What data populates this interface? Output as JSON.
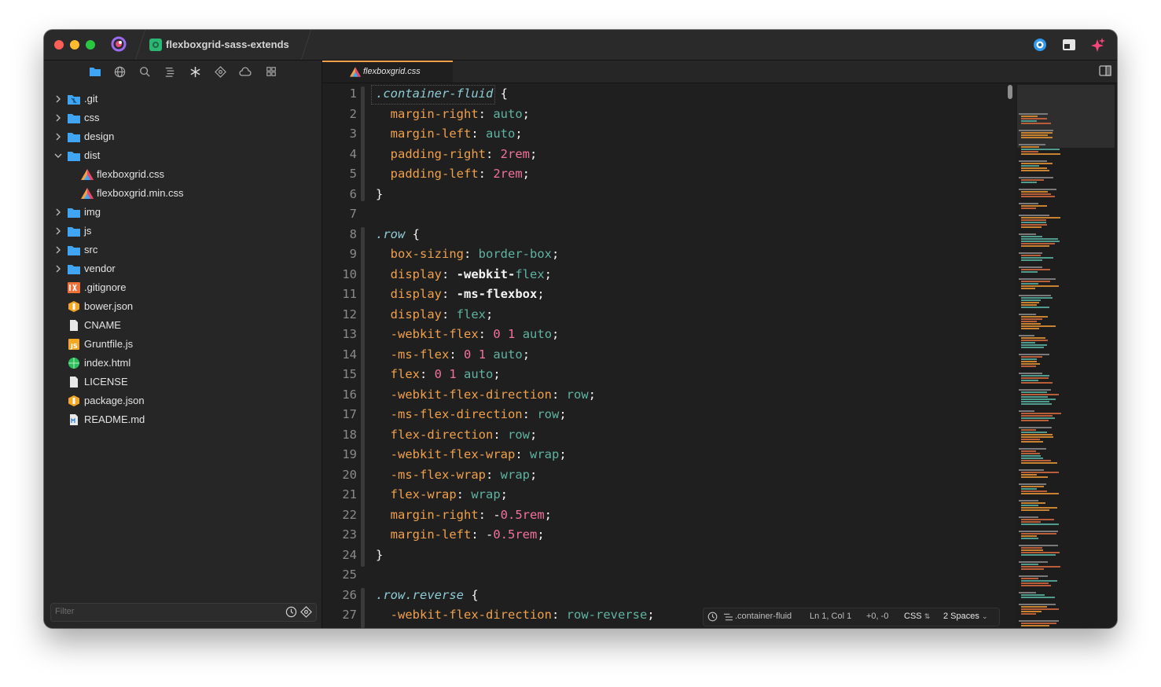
{
  "window": {
    "project_name": "flexboxgrid-sass-extends"
  },
  "sidebar": {
    "filter_placeholder": "Filter",
    "items": [
      {
        "label": ".git",
        "kind": "folder",
        "expanded": false,
        "depth": 0,
        "icon": "git-folder-icon"
      },
      {
        "label": "css",
        "kind": "folder",
        "expanded": false,
        "depth": 0,
        "icon": "folder-icon"
      },
      {
        "label": "design",
        "kind": "folder",
        "expanded": false,
        "depth": 0,
        "icon": "folder-icon"
      },
      {
        "label": "dist",
        "kind": "folder",
        "expanded": true,
        "depth": 0,
        "icon": "folder-icon"
      },
      {
        "label": "flexboxgrid.css",
        "kind": "file",
        "depth": 1,
        "icon": "css-file-icon"
      },
      {
        "label": "flexboxgrid.min.css",
        "kind": "file",
        "depth": 1,
        "icon": "css-file-icon"
      },
      {
        "label": "img",
        "kind": "folder",
        "expanded": false,
        "depth": 0,
        "icon": "folder-icon"
      },
      {
        "label": "js",
        "kind": "folder",
        "expanded": false,
        "depth": 0,
        "icon": "folder-icon"
      },
      {
        "label": "src",
        "kind": "folder",
        "expanded": false,
        "depth": 0,
        "icon": "folder-icon"
      },
      {
        "label": "vendor",
        "kind": "folder",
        "expanded": false,
        "depth": 0,
        "icon": "folder-icon"
      },
      {
        "label": ".gitignore",
        "kind": "file",
        "depth": 0,
        "icon": "gitignore-file-icon"
      },
      {
        "label": "bower.json",
        "kind": "file",
        "depth": 0,
        "icon": "json-file-icon"
      },
      {
        "label": "CNAME",
        "kind": "file",
        "depth": 0,
        "icon": "document-file-icon"
      },
      {
        "label": "Gruntfile.js",
        "kind": "file",
        "depth": 0,
        "icon": "js-file-icon"
      },
      {
        "label": "index.html",
        "kind": "file",
        "depth": 0,
        "icon": "html-file-icon"
      },
      {
        "label": "LICENSE",
        "kind": "file",
        "depth": 0,
        "icon": "document-file-icon"
      },
      {
        "label": "package.json",
        "kind": "file",
        "depth": 0,
        "icon": "json-file-icon"
      },
      {
        "label": "README.md",
        "kind": "file",
        "depth": 0,
        "icon": "markdown-file-icon"
      }
    ]
  },
  "editor": {
    "tab_label": "flexboxgrid.css",
    "lines": [
      [
        [
          "sel",
          ".container-fluid"
        ],
        [
          "br",
          " {"
        ]
      ],
      [
        [
          "pl",
          "  "
        ],
        [
          "prop",
          "margin-right"
        ],
        [
          "br",
          ": "
        ],
        [
          "val",
          "auto"
        ],
        [
          "br",
          ";"
        ]
      ],
      [
        [
          "pl",
          "  "
        ],
        [
          "prop",
          "margin-left"
        ],
        [
          "br",
          ": "
        ],
        [
          "val",
          "auto"
        ],
        [
          "br",
          ";"
        ]
      ],
      [
        [
          "pl",
          "  "
        ],
        [
          "prop",
          "padding-right"
        ],
        [
          "br",
          ": "
        ],
        [
          "num",
          "2rem"
        ],
        [
          "br",
          ";"
        ]
      ],
      [
        [
          "pl",
          "  "
        ],
        [
          "prop",
          "padding-left"
        ],
        [
          "br",
          ": "
        ],
        [
          "num",
          "2rem"
        ],
        [
          "br",
          ";"
        ]
      ],
      [
        [
          "br",
          "}"
        ]
      ],
      [],
      [
        [
          "sel",
          ".row"
        ],
        [
          "br",
          " {"
        ]
      ],
      [
        [
          "pl",
          "  "
        ],
        [
          "prop",
          "box-sizing"
        ],
        [
          "br",
          ": "
        ],
        [
          "val",
          "border-box"
        ],
        [
          "br",
          ";"
        ]
      ],
      [
        [
          "pl",
          "  "
        ],
        [
          "prop",
          "display"
        ],
        [
          "br",
          ": "
        ],
        [
          "kw",
          "-webkit-"
        ],
        [
          "val",
          "flex"
        ],
        [
          "br",
          ";"
        ]
      ],
      [
        [
          "pl",
          "  "
        ],
        [
          "prop",
          "display"
        ],
        [
          "br",
          ": "
        ],
        [
          "kw",
          "-ms-flexbox"
        ],
        [
          "br",
          ";"
        ]
      ],
      [
        [
          "pl",
          "  "
        ],
        [
          "prop",
          "display"
        ],
        [
          "br",
          ": "
        ],
        [
          "val",
          "flex"
        ],
        [
          "br",
          ";"
        ]
      ],
      [
        [
          "pl",
          "  "
        ],
        [
          "prop",
          "-webkit-flex"
        ],
        [
          "br",
          ": "
        ],
        [
          "num",
          "0"
        ],
        [
          "br",
          " "
        ],
        [
          "num",
          "1"
        ],
        [
          "br",
          " "
        ],
        [
          "val",
          "auto"
        ],
        [
          "br",
          ";"
        ]
      ],
      [
        [
          "pl",
          "  "
        ],
        [
          "prop",
          "-ms-flex"
        ],
        [
          "br",
          ": "
        ],
        [
          "num",
          "0"
        ],
        [
          "br",
          " "
        ],
        [
          "num",
          "1"
        ],
        [
          "br",
          " "
        ],
        [
          "val",
          "auto"
        ],
        [
          "br",
          ";"
        ]
      ],
      [
        [
          "pl",
          "  "
        ],
        [
          "prop",
          "flex"
        ],
        [
          "br",
          ": "
        ],
        [
          "num",
          "0"
        ],
        [
          "br",
          " "
        ],
        [
          "num",
          "1"
        ],
        [
          "br",
          " "
        ],
        [
          "val",
          "auto"
        ],
        [
          "br",
          ";"
        ]
      ],
      [
        [
          "pl",
          "  "
        ],
        [
          "prop",
          "-webkit-flex-direction"
        ],
        [
          "br",
          ": "
        ],
        [
          "val",
          "row"
        ],
        [
          "br",
          ";"
        ]
      ],
      [
        [
          "pl",
          "  "
        ],
        [
          "prop",
          "-ms-flex-direction"
        ],
        [
          "br",
          ": "
        ],
        [
          "val",
          "row"
        ],
        [
          "br",
          ";"
        ]
      ],
      [
        [
          "pl",
          "  "
        ],
        [
          "prop",
          "flex-direction"
        ],
        [
          "br",
          ": "
        ],
        [
          "val",
          "row"
        ],
        [
          "br",
          ";"
        ]
      ],
      [
        [
          "pl",
          "  "
        ],
        [
          "prop",
          "-webkit-flex-wrap"
        ],
        [
          "br",
          ": "
        ],
        [
          "val",
          "wrap"
        ],
        [
          "br",
          ";"
        ]
      ],
      [
        [
          "pl",
          "  "
        ],
        [
          "prop",
          "-ms-flex-wrap"
        ],
        [
          "br",
          ": "
        ],
        [
          "val",
          "wrap"
        ],
        [
          "br",
          ";"
        ]
      ],
      [
        [
          "pl",
          "  "
        ],
        [
          "prop",
          "flex-wrap"
        ],
        [
          "br",
          ": "
        ],
        [
          "val",
          "wrap"
        ],
        [
          "br",
          ";"
        ]
      ],
      [
        [
          "pl",
          "  "
        ],
        [
          "prop",
          "margin-right"
        ],
        [
          "br",
          ": "
        ],
        [
          "br",
          "-"
        ],
        [
          "num",
          "0.5rem"
        ],
        [
          "br",
          ";"
        ]
      ],
      [
        [
          "pl",
          "  "
        ],
        [
          "prop",
          "margin-left"
        ],
        [
          "br",
          ": "
        ],
        [
          "br",
          "-"
        ],
        [
          "num",
          "0.5rem"
        ],
        [
          "br",
          ";"
        ]
      ],
      [
        [
          "br",
          "}"
        ]
      ],
      [],
      [
        [
          "sel",
          ".row.reverse"
        ],
        [
          "br",
          " {"
        ]
      ],
      [
        [
          "pl",
          "  "
        ],
        [
          "prop",
          "-webkit-flex-direction"
        ],
        [
          "br",
          ": "
        ],
        [
          "val",
          "row-reverse"
        ],
        [
          "br",
          ";"
        ]
      ]
    ]
  },
  "status": {
    "symbol": ".container-fluid",
    "position": "Ln 1, Col 1",
    "diff": "+0, -0",
    "language": "CSS",
    "indent": "2 Spaces"
  },
  "colors": {
    "selector": "#8ecbd6",
    "property": "#f0a04b",
    "value": "#5fb3a1",
    "number": "#f3719a",
    "folder": "#3ea6f5"
  }
}
